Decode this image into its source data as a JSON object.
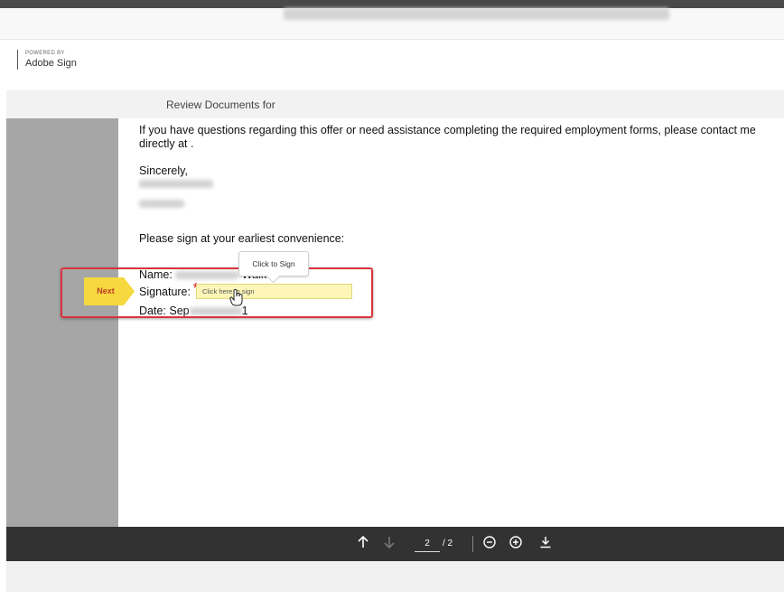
{
  "brand": {
    "powered": "POWERED BY",
    "name": "Adobe Sign"
  },
  "titlebar": {
    "prefix": "Review Documents for"
  },
  "document": {
    "paragraph": "If you have questions regarding this offer or need assistance completing the required employment forms, please contact me directly at .",
    "closing": "Sincerely,",
    "instruction": "Please sign at your earliest convenience:",
    "name_label": "Name:",
    "name_visible_fragment": "Walker",
    "signature_label": "Signature:",
    "date_label": "Date:",
    "date_visible_start": "Sep",
    "date_visible_end": "1"
  },
  "signing": {
    "next_label": "Next",
    "tooltip": "Click to Sign",
    "field_placeholder": "Click here to sign",
    "required_marker": "*"
  },
  "footer": {
    "current_page": "2",
    "total_pages": "/ 2",
    "icons": [
      "arrow-up-icon",
      "arrow-down-icon",
      "zoom-out-icon",
      "zoom-in-icon",
      "download-icon"
    ]
  },
  "colors": {
    "highlight_border": "#d9343b",
    "field_background": "#fdf6b8",
    "next_tag": "#f5d93e",
    "footer_bar": "#323232",
    "gutter": "#a6a6a6"
  }
}
